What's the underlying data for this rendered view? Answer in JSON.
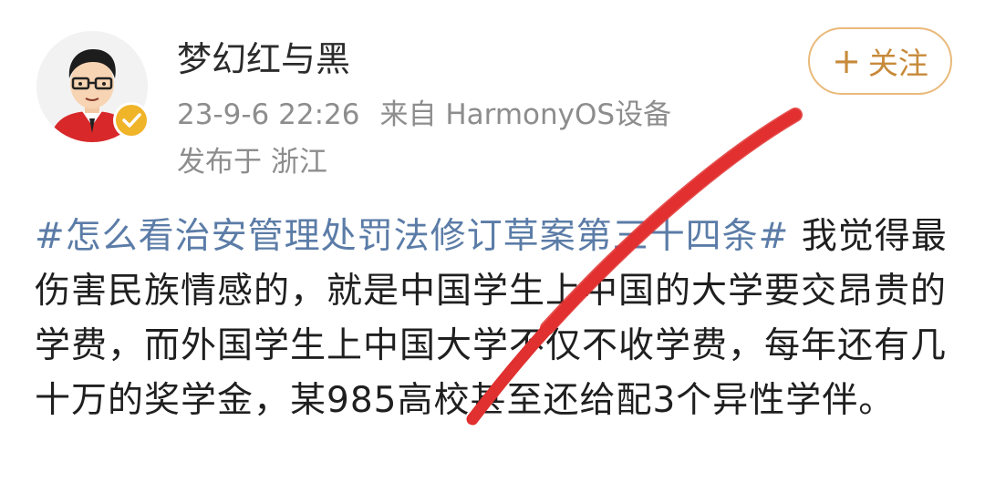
{
  "user": {
    "name": "梦幻红与黑",
    "avatar_icon": "cartoon-avatar-with-glasses",
    "verified_icon": "verified-badge-icon",
    "verified_color": "#f0b429"
  },
  "post_meta": {
    "date": "23-9-6 22:26",
    "source": "来自 HarmonyOS设备",
    "location": "发布于 浙江"
  },
  "follow_button": {
    "plus": "+",
    "label": "关注",
    "color": "#c78a3a"
  },
  "post": {
    "hashtag": "#怎么看治安管理处罚法修订草案第三十四条#",
    "body": " 我觉得最伤害民族情感的，就是中国学生上中国的大学要交昂贵的学费，而外国学生上中国大学不仅不收学费，每年还有几十万的奖学金，某985高校甚至还给配3个异性学伴。",
    "hashtag_color": "#5b7ca7"
  },
  "overlay": {
    "strike_color": "#e0302f"
  }
}
